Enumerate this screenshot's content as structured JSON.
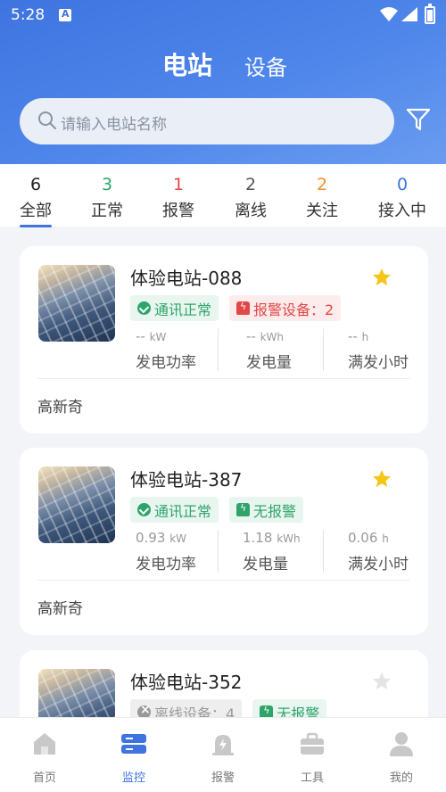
{
  "status_bar": {
    "time": "5:28"
  },
  "header": {
    "tabs": [
      {
        "label": "电站",
        "active": true
      },
      {
        "label": "设备",
        "active": false
      }
    ],
    "search": {
      "placeholder": "请输入电站名称"
    }
  },
  "categories": [
    {
      "count": "6",
      "label": "全部",
      "color": "#222222",
      "active": true
    },
    {
      "count": "3",
      "label": "正常",
      "color": "#2fa46a"
    },
    {
      "count": "1",
      "label": "报警",
      "color": "#e04848"
    },
    {
      "count": "2",
      "label": "离线",
      "color": "#555555"
    },
    {
      "count": "2",
      "label": "关注",
      "color": "#f0902a"
    },
    {
      "count": "0",
      "label": "接入中",
      "color": "#3f74e0"
    }
  ],
  "stations": [
    {
      "name": "体验电站-088",
      "starred": true,
      "badge1": "通讯正常",
      "badge2": "报警设备：2",
      "power": {
        "value": "--",
        "unit": "kW",
        "label": "发电功率"
      },
      "energy": {
        "value": "--",
        "unit": "kWh",
        "label": "发电量"
      },
      "hours": {
        "value": "--",
        "unit": "h",
        "label": "满发小时"
      },
      "owner": "高新奇"
    },
    {
      "name": "体验电站-387",
      "starred": true,
      "badge1": "通讯正常",
      "badge2": "无报警",
      "power": {
        "value": "0.93",
        "unit": "kW",
        "label": "发电功率"
      },
      "energy": {
        "value": "1.18",
        "unit": "kWh",
        "label": "发电量"
      },
      "hours": {
        "value": "0.06",
        "unit": "h",
        "label": "满发小时"
      },
      "owner": "高新奇"
    },
    {
      "name": "体验电站-352",
      "starred": false,
      "badge1": "离线设备：4",
      "badge2": "无报警"
    }
  ],
  "tab_bar": [
    {
      "label": "首页",
      "icon": "home-icon"
    },
    {
      "label": "监控",
      "icon": "monitor-icon",
      "active": true
    },
    {
      "label": "报警",
      "icon": "alarm-icon"
    },
    {
      "label": "工具",
      "icon": "toolbox-icon"
    },
    {
      "label": "我的",
      "icon": "user-icon"
    }
  ],
  "colors": {
    "accent": "#3f74e0",
    "ok": "#2fa46a",
    "alarm": "#e04848",
    "star": "#f5c518"
  }
}
